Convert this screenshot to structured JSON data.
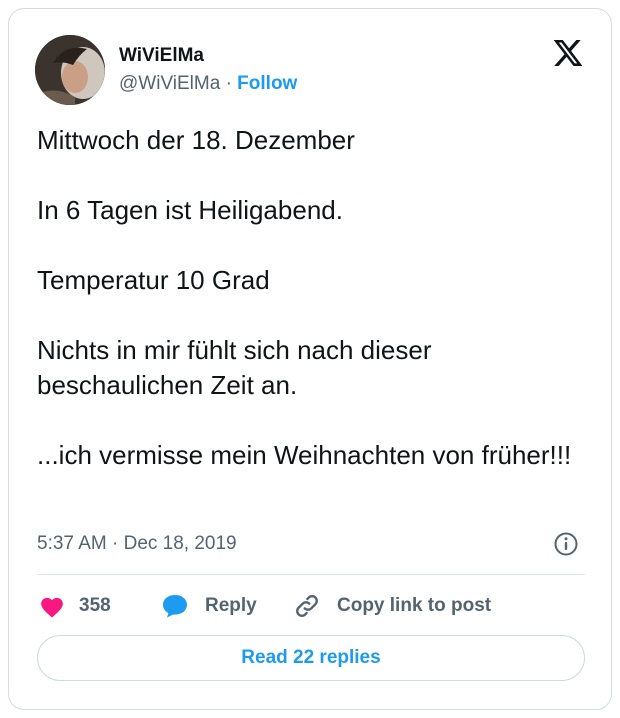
{
  "author": {
    "display_name": "WiViElMa",
    "handle": "@WiViElMa",
    "separator": "·",
    "follow_label": "Follow"
  },
  "logo": "x-logo-icon",
  "tweet": {
    "paragraphs": [
      "Mittwoch der 18. Dezember",
      "In 6 Tagen ist Heiligabend.",
      "Temperatur 10 Grad",
      "Nichts in mir fühlt sich nach dieser beschaulichen Zeit an.",
      "...ich vermisse mein Weihnachten von früher!!!"
    ],
    "timestamp": "5:37 AM · Dec 18, 2019"
  },
  "actions": {
    "like_count": "358",
    "reply_label": "Reply",
    "copy_label": "Copy link to post"
  },
  "read_replies_label": "Read 22 replies",
  "colors": {
    "accent": "#1d9bf0",
    "heart": "#f91880",
    "text": "#0f1419",
    "muted": "#536471"
  }
}
